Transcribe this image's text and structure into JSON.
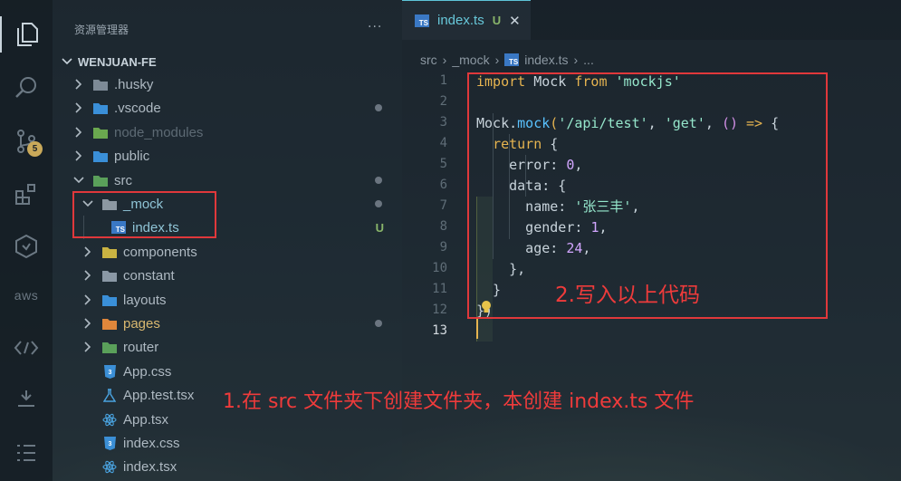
{
  "sidebar": {
    "title": "资源管理器",
    "more": "···",
    "root": "WENJUAN-FE",
    "items": [
      {
        "label": ".husky",
        "kind": "folder",
        "icon": "folder-husky-icon",
        "dim": false,
        "status": ""
      },
      {
        "label": ".vscode",
        "kind": "folder",
        "icon": "folder-vscode-icon",
        "dim": false,
        "status": "dot"
      },
      {
        "label": "node_modules",
        "kind": "folder",
        "icon": "folder-node-icon",
        "dim": true,
        "status": ""
      },
      {
        "label": "public",
        "kind": "folder",
        "icon": "folder-public-icon",
        "dim": false,
        "status": ""
      },
      {
        "label": "src",
        "kind": "folder-open",
        "icon": "folder-src-icon",
        "dim": false,
        "status": "dot"
      },
      {
        "label": "_mock",
        "kind": "folder-open",
        "icon": "folder-mock-icon",
        "dim": false,
        "status": "dot"
      },
      {
        "label": "index.ts",
        "kind": "file",
        "icon": "typescript-file-icon",
        "dim": false,
        "status": "U"
      },
      {
        "label": "components",
        "kind": "folder",
        "icon": "folder-components-icon",
        "dim": false,
        "status": ""
      },
      {
        "label": "constant",
        "kind": "folder",
        "icon": "folder-constant-icon",
        "dim": false,
        "status": ""
      },
      {
        "label": "layouts",
        "kind": "folder",
        "icon": "folder-layouts-icon",
        "dim": false,
        "status": ""
      },
      {
        "label": "pages",
        "kind": "folder",
        "icon": "folder-pages-icon",
        "dim": false,
        "status": "dot"
      },
      {
        "label": "router",
        "kind": "folder",
        "icon": "folder-router-icon",
        "dim": false,
        "status": ""
      },
      {
        "label": "App.css",
        "kind": "file",
        "icon": "css-file-icon",
        "dim": false,
        "status": ""
      },
      {
        "label": "App.test.tsx",
        "kind": "file",
        "icon": "test-file-icon",
        "dim": false,
        "status": ""
      },
      {
        "label": "App.tsx",
        "kind": "file",
        "icon": "react-file-icon",
        "dim": false,
        "status": ""
      },
      {
        "label": "index.css",
        "kind": "file",
        "icon": "css-file-icon",
        "dim": false,
        "status": ""
      },
      {
        "label": "index.tsx",
        "kind": "file",
        "icon": "react-file-icon",
        "dim": false,
        "status": ""
      }
    ]
  },
  "activity": {
    "scm_badge": "5",
    "aws_label": "aws"
  },
  "editor": {
    "tab": {
      "name": "index.ts",
      "ts_badge": "TS",
      "status": "U",
      "close": "✕"
    },
    "breadcrumb": [
      "src",
      "_mock",
      "index.ts",
      "..."
    ],
    "line_numbers": [
      "1",
      "2",
      "3",
      "4",
      "5",
      "6",
      "7",
      "8",
      "9",
      "10",
      "11",
      "12",
      "13"
    ],
    "current_line": "13",
    "code_lines": [
      "import Mock from 'mockjs'",
      "",
      "Mock.mock('/api/test', 'get', () => {",
      "  return {",
      "    error: 0,",
      "    data: {",
      "      name: '张三丰',",
      "      gender: 1,",
      "      age: 24,",
      "    },",
      "  }",
      "})",
      ""
    ]
  },
  "annotations": {
    "step1": "1.在 src 文件夹下创建文件夹，本创建 index.ts 文件",
    "step2": "2.写入以上代码"
  },
  "colors": {
    "highlight_box": "#e0383b",
    "annotation_text": "#ef3b3b",
    "tab_accent": "#5ec4d8"
  }
}
